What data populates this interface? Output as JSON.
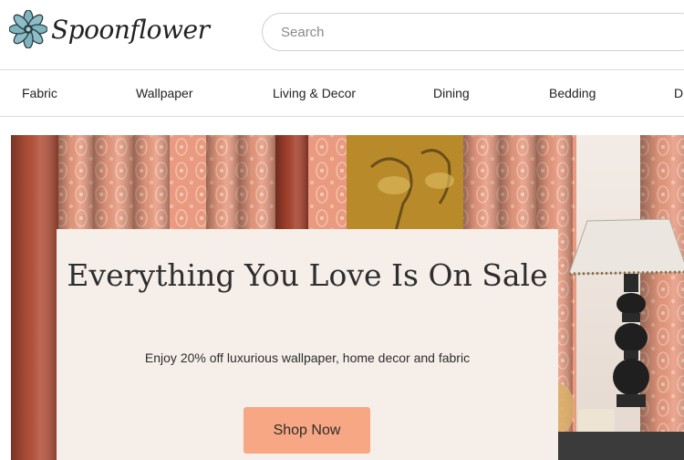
{
  "brand": {
    "name": "Spoonflower",
    "logo_icon": "flower-logo-icon",
    "accent_color": "#5a8f9a"
  },
  "search": {
    "placeholder": "Search"
  },
  "nav": {
    "items": [
      {
        "label": "Fabric"
      },
      {
        "label": "Wallpaper"
      },
      {
        "label": "Living & Decor"
      },
      {
        "label": "Dining"
      },
      {
        "label": "Bedding"
      },
      {
        "label": "D"
      }
    ]
  },
  "hero": {
    "title": "Everything You Love Is On Sale",
    "subtitle": "Enjoy 20% off luxurious wallpaper, home decor and fabric",
    "cta_label": "Shop Now",
    "cta_color": "#f7a783"
  }
}
